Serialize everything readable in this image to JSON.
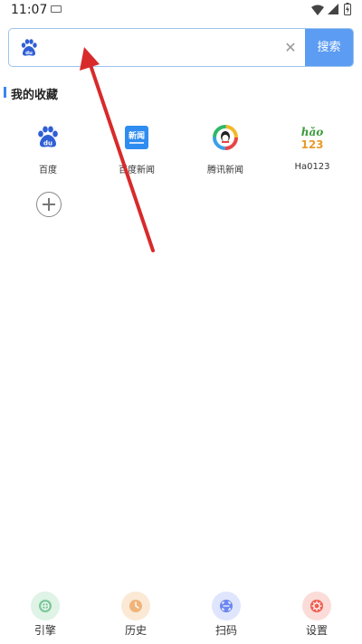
{
  "status_bar": {
    "time": "11:07"
  },
  "search": {
    "engine_icon": "baidu-paw-icon",
    "placeholder": "",
    "value": "",
    "clear_icon": "close-icon",
    "button_label": "搜索"
  },
  "favorites": {
    "title": "我的收藏",
    "items": [
      {
        "label": "百度",
        "icon": "baidu-paw-icon"
      },
      {
        "label": "百度新闻",
        "icon": "baidu-news-icon",
        "icon_text": "新闻"
      },
      {
        "label": "腾讯新闻",
        "icon": "tencent-news-icon"
      },
      {
        "label": "Ha0123",
        "icon": "hao123-icon",
        "icon_text_top": "hǎo",
        "icon_text_bottom": "123"
      }
    ],
    "add_icon": "plus-circle-icon"
  },
  "bottom_nav": {
    "items": [
      {
        "label": "引擎",
        "icon": "engine-icon",
        "color": "#7cc99a"
      },
      {
        "label": "历史",
        "icon": "clock-icon",
        "color": "#f0b47a"
      },
      {
        "label": "扫码",
        "icon": "scan-icon",
        "color": "#6b87f0"
      },
      {
        "label": "设置",
        "icon": "gear-icon",
        "color": "#ef5d4f"
      }
    ]
  },
  "colors": {
    "accent": "#5c9cf3",
    "annotation_arrow": "#d82a2a"
  }
}
